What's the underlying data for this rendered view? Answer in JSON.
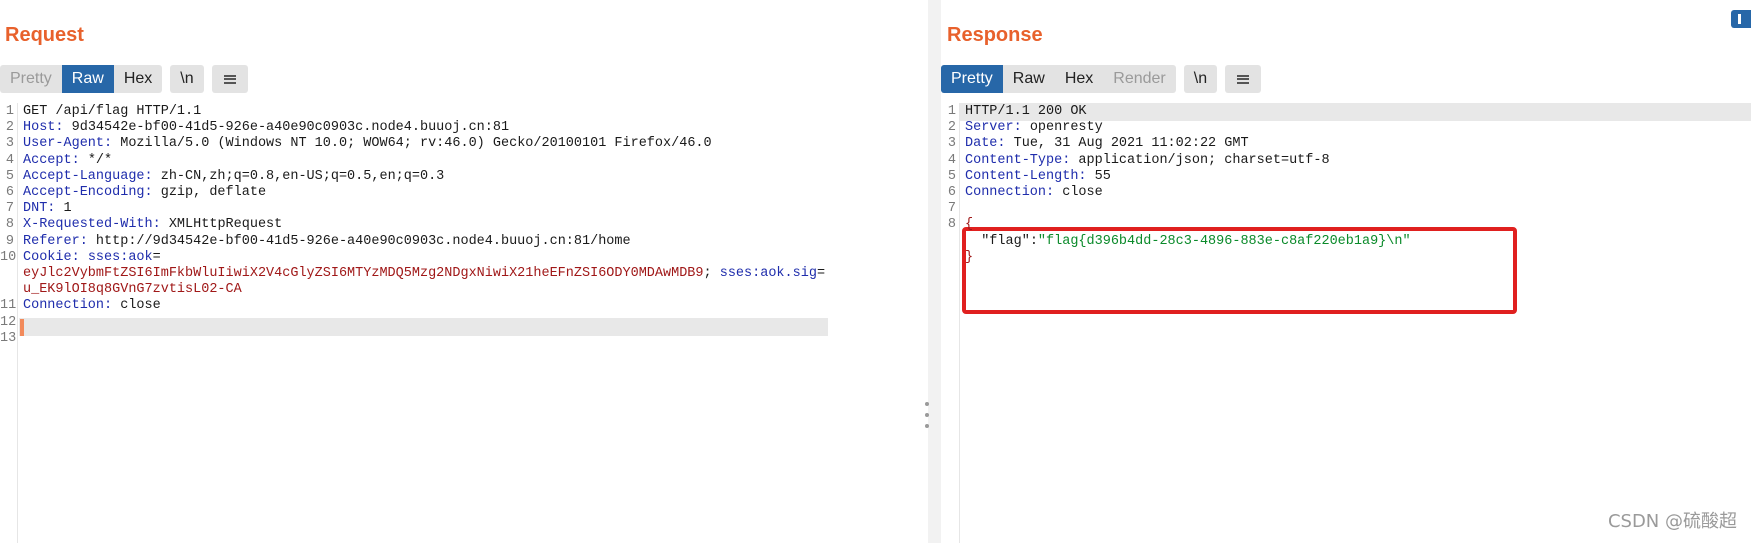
{
  "request": {
    "title": "Request",
    "tabs": [
      {
        "label": "Pretty",
        "state": "dim"
      },
      {
        "label": "Raw",
        "state": "active"
      },
      {
        "label": "Hex",
        "state": "normal"
      }
    ],
    "newline_label": "\\n",
    "lines": [
      {
        "n": "1",
        "parts": [
          {
            "t": "GET /api/flag HTTP/1.1",
            "c": "plain"
          }
        ]
      },
      {
        "n": "2",
        "parts": [
          {
            "t": "Host:",
            "c": "hkey"
          },
          {
            "t": " 9d34542e-bf00-41d5-926e-a40e90c0903c.node4.buuoj.cn:81",
            "c": "plain"
          }
        ]
      },
      {
        "n": "3",
        "parts": [
          {
            "t": "User-Agent:",
            "c": "hkey"
          },
          {
            "t": " Mozilla/5.0 (Windows NT 10.0; WOW64; rv:46.0) Gecko/20100101 Firefox/46.0",
            "c": "plain"
          }
        ]
      },
      {
        "n": "4",
        "parts": [
          {
            "t": "Accept:",
            "c": "hkey"
          },
          {
            "t": " */*",
            "c": "plain"
          }
        ]
      },
      {
        "n": "5",
        "parts": [
          {
            "t": "Accept-Language:",
            "c": "hkey"
          },
          {
            "t": " zh-CN,zh;q=0.8,en-US;q=0.5,en;q=0.3",
            "c": "plain"
          }
        ]
      },
      {
        "n": "6",
        "parts": [
          {
            "t": "Accept-Encoding:",
            "c": "hkey"
          },
          {
            "t": " gzip, deflate",
            "c": "plain"
          }
        ]
      },
      {
        "n": "7",
        "parts": [
          {
            "t": "DNT:",
            "c": "hkey"
          },
          {
            "t": " 1",
            "c": "plain"
          }
        ]
      },
      {
        "n": "8",
        "parts": [
          {
            "t": "X-Requested-With:",
            "c": "hkey"
          },
          {
            "t": " XMLHttpRequest",
            "c": "plain"
          }
        ]
      },
      {
        "n": "9",
        "parts": [
          {
            "t": "Referer:",
            "c": "hkey"
          },
          {
            "t": " http://9d34542e-bf00-41d5-926e-a40e90c0903c.node4.buuoj.cn:81/home",
            "c": "plain"
          }
        ]
      },
      {
        "n": "10",
        "parts": [
          {
            "t": "Cookie:",
            "c": "hkey"
          },
          {
            "t": " sses:aok",
            "c": "hkey"
          },
          {
            "t": "=",
            "c": "plain"
          }
        ]
      },
      {
        "n": "",
        "parts": [
          {
            "t": "eyJlc2VybmFtZSI6ImFkbWluIiwiX2V4cGlyZSI6MTYzMDQ5Mzg2NDgxNiwiX21heEFnZSI6ODY0MDAwMDB9",
            "c": "cval"
          },
          {
            "t": "; ",
            "c": "plain"
          },
          {
            "t": "sses:aok.sig",
            "c": "hkey"
          },
          {
            "t": "=",
            "c": "plain"
          }
        ]
      },
      {
        "n": "",
        "parts": [
          {
            "t": "u_EK9lOI8q8GVnG7zvtisL02-CA",
            "c": "cval"
          }
        ]
      },
      {
        "n": "11",
        "parts": [
          {
            "t": "Connection:",
            "c": "hkey"
          },
          {
            "t": " close",
            "c": "plain"
          }
        ]
      },
      {
        "n": "12",
        "parts": []
      },
      {
        "n": "13",
        "parts": []
      }
    ]
  },
  "response": {
    "title": "Response",
    "tabs": [
      {
        "label": "Pretty",
        "state": "active"
      },
      {
        "label": "Raw",
        "state": "normal"
      },
      {
        "label": "Hex",
        "state": "normal"
      },
      {
        "label": "Render",
        "state": "dim"
      }
    ],
    "newline_label": "\\n",
    "lines": [
      {
        "n": "1",
        "parts": [
          {
            "t": "HTTP/1.1 200 OK",
            "c": "plain"
          }
        ]
      },
      {
        "n": "2",
        "parts": [
          {
            "t": "Server:",
            "c": "hkey"
          },
          {
            "t": " openresty",
            "c": "plain"
          }
        ]
      },
      {
        "n": "3",
        "parts": [
          {
            "t": "Date:",
            "c": "hkey"
          },
          {
            "t": " Tue, 31 Aug 2021 11:02:22 GMT",
            "c": "plain"
          }
        ]
      },
      {
        "n": "4",
        "parts": [
          {
            "t": "Content-Type:",
            "c": "hkey"
          },
          {
            "t": " application/json; charset=utf-8",
            "c": "plain"
          }
        ]
      },
      {
        "n": "5",
        "parts": [
          {
            "t": "Content-Length:",
            "c": "hkey"
          },
          {
            "t": " 55",
            "c": "plain"
          }
        ]
      },
      {
        "n": "6",
        "parts": [
          {
            "t": "Connection:",
            "c": "hkey"
          },
          {
            "t": " close",
            "c": "plain"
          }
        ]
      },
      {
        "n": "7",
        "parts": []
      },
      {
        "n": "8",
        "parts": [
          {
            "t": "{",
            "c": "brace"
          }
        ]
      },
      {
        "n": "",
        "parts": [
          {
            "t": "  \"flag\"",
            "c": "jkey"
          },
          {
            "t": ":",
            "c": "plain"
          },
          {
            "t": "\"flag{d396b4dd-28c3-4896-883e-c8af220eb1a9}\\n\"",
            "c": "jval"
          }
        ]
      },
      {
        "n": "",
        "parts": [
          {
            "t": "}",
            "c": "brace"
          }
        ]
      }
    ]
  },
  "watermark": "CSDN @硫酸超",
  "colors": {
    "accent_title": "#e8612c",
    "active_tab": "#2767a8",
    "highlight_box": "#e0201f",
    "header_key": "#1f2dac",
    "cookie_value": "#a01818",
    "json_string": "#0a8a2a"
  }
}
